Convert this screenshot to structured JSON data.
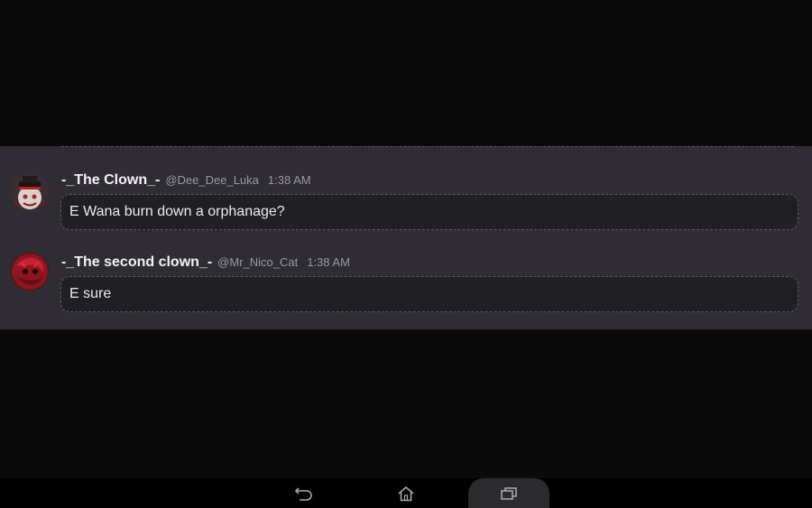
{
  "messages": [
    {
      "username": "-_The Clown_-",
      "handle": "@Dee_Dee_Luka",
      "time": "1:38 AM",
      "text": "E Wana burn down a orphanage?",
      "avatar_icon": "clown-avatar-icon"
    },
    {
      "username": "-_The second clown_-",
      "handle": "@Mr_Nico_Cat",
      "time": "1:38 AM",
      "text": "E sure",
      "avatar_icon": "red-avatar-icon"
    }
  ],
  "navigation": {
    "back_icon": "back-arrow-icon",
    "home_icon": "home-icon",
    "recents_icon": "recent-apps-icon"
  },
  "colors": {
    "background": "#0b0a0b",
    "panel": "#2f2d33",
    "bubble": "#201f24",
    "text": "#ebebee",
    "muted": "#9a97a0"
  }
}
